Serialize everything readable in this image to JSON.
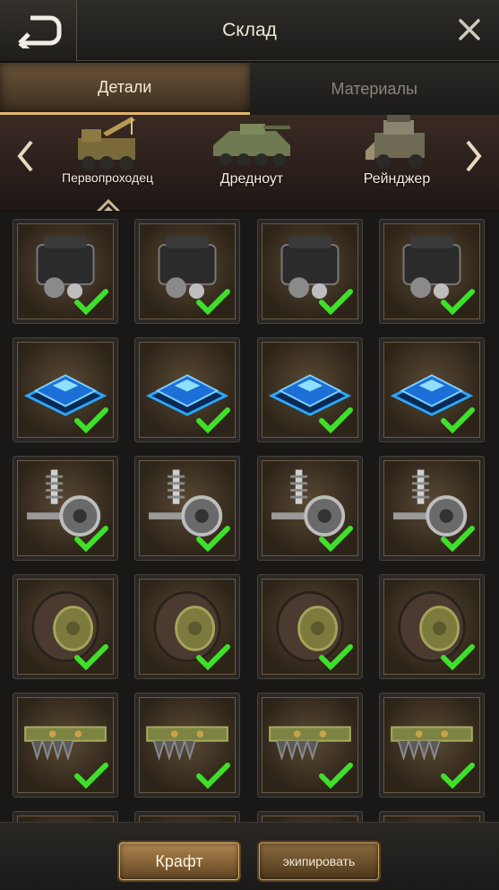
{
  "header": {
    "title": "Склад"
  },
  "tabs": [
    {
      "label": "Детали",
      "active": true
    },
    {
      "label": "Материалы",
      "active": false
    }
  ],
  "vehicles": [
    {
      "name": "Первопроходец",
      "icon": "crane-truck-icon",
      "selected": true
    },
    {
      "name": "Дредноут",
      "icon": "armored-vehicle-icon",
      "selected": false
    },
    {
      "name": "Рейнджер",
      "icon": "armored-truck-icon",
      "selected": false
    }
  ],
  "parts_rows": [
    {
      "part": "engine",
      "icon": "engine-icon",
      "equipped": [
        true,
        true,
        true,
        true
      ]
    },
    {
      "part": "chip",
      "icon": "chip-icon",
      "equipped": [
        true,
        true,
        true,
        true
      ]
    },
    {
      "part": "suspension",
      "icon": "suspension-icon",
      "equipped": [
        true,
        true,
        true,
        true
      ]
    },
    {
      "part": "wheel",
      "icon": "wheel-icon",
      "equipped": [
        true,
        true,
        true,
        true
      ]
    },
    {
      "part": "bumper",
      "icon": "spiked-bumper-icon",
      "equipped": [
        true,
        true,
        true,
        true
      ]
    }
  ],
  "footer": {
    "craft_label": "Крафт",
    "equip_label": "экипировать"
  },
  "colors": {
    "accent": "#e2b56b",
    "check": "#3fe02a",
    "chip_glow": "#2aa8ff"
  }
}
